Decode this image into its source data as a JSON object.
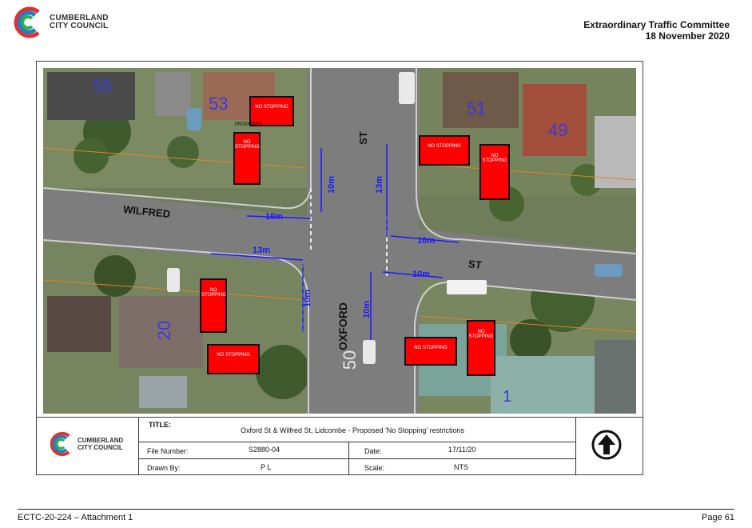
{
  "header": {
    "logo_line1": "CUMBERLAND",
    "logo_line2": "CITY COUNCIL",
    "committee": "Extraordinary Traffic Committee",
    "date": "18 November 2020"
  },
  "map": {
    "street_labels": [
      "WILFRED",
      "ST",
      "ST",
      "OXFORD"
    ],
    "lot_numbers": [
      "55",
      "53",
      "51",
      "49",
      "20",
      "1"
    ],
    "road_marking": "50",
    "dimension_labels": [
      "10m",
      "10m",
      "13m",
      "13m",
      "10m",
      "10m",
      "10m",
      "10m"
    ],
    "sign_text": "NO STOPPING",
    "proposed_label": "PROPOSED"
  },
  "title_block": {
    "logo_line1": "CUMBERLAND",
    "logo_line2": "CITY COUNCIL",
    "title_label": "TITLE:",
    "title_value": "Oxford St & Wilfred St, Lidcombe - Proposed 'No Stopping' restrictions",
    "file_number_label": "File Number:",
    "file_number_value": "S2880-04",
    "date_label": "Date:",
    "date_value": "17/11/20",
    "drawn_by_label": "Drawn By:",
    "drawn_by_value": "P L",
    "scale_label": "Scale:",
    "scale_value": "NTS",
    "north_icon": "north-arrow-icon"
  },
  "footer": {
    "left": "ECTC-20-224 – Attachment 1",
    "right": "Page 61"
  },
  "colors": {
    "sign_red": "#ff0000",
    "dimension_blue": "#1a1aff",
    "road_grey": "#7d7d7d"
  }
}
